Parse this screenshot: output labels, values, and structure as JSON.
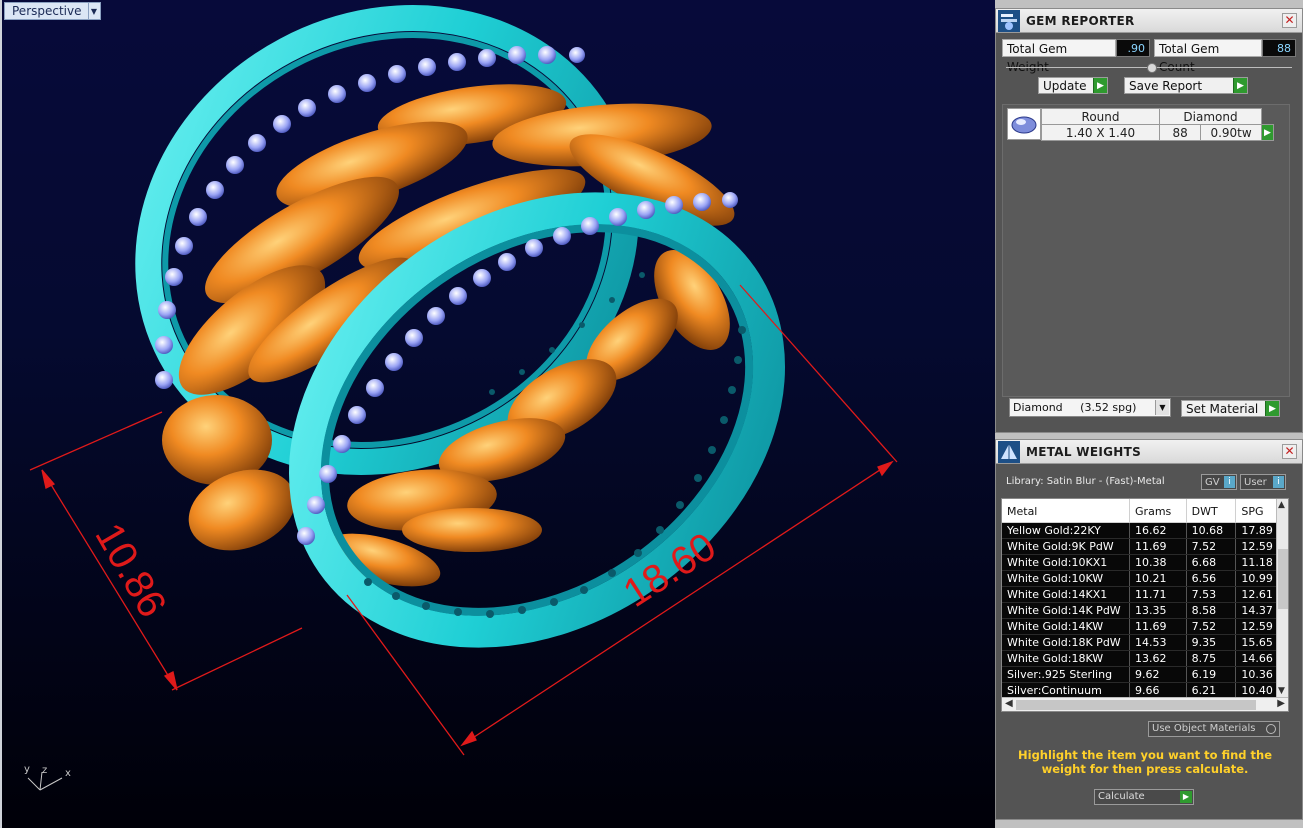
{
  "viewport": {
    "tab_label": "Perspective",
    "dimension_height": "10.86",
    "dimension_width": "18.60",
    "axis_labels": {
      "x": "x",
      "y": "y",
      "z": "z"
    },
    "colors": {
      "metal_gold": "#e98a2c",
      "setting_cyan": "#2ad4d8",
      "dimension": "#e01a1a"
    }
  },
  "gem_reporter": {
    "title": "GEM REPORTER",
    "close_glyph": "✕",
    "total_gem_weight_label": "Total Gem Weight",
    "total_gem_weight_value": ".90",
    "total_gem_count_label": "Total Gem Count",
    "total_gem_count_value": "88",
    "update_label": "Update",
    "save_report_label": "Save Report",
    "gem": {
      "shape": "Round",
      "material": "Diamond",
      "size": "1.40 X 1.40",
      "count": "88",
      "weight": "0.90tw"
    },
    "material_select_value": "Diamond     (3.52 spg)",
    "set_material_label": "Set Material"
  },
  "metal_weights": {
    "title": "METAL WEIGHTS",
    "close_glyph": "✕",
    "library_label": "Library: Satin Blur - (Fast)-Metal",
    "gv_label": "GV",
    "user_label": "User",
    "columns": [
      "Metal",
      "Grams",
      "DWT",
      "SPG"
    ],
    "rows": [
      [
        "Yellow Gold:22KY",
        "16.62",
        "10.68",
        "17.89"
      ],
      [
        "White Gold:9K PdW",
        "11.69",
        "7.52",
        "12.59"
      ],
      [
        "White Gold:10KX1",
        "10.38",
        "6.68",
        "11.18"
      ],
      [
        "White Gold:10KW",
        "10.21",
        "6.56",
        "10.99"
      ],
      [
        "White Gold:14KX1",
        "11.71",
        "7.53",
        "12.61"
      ],
      [
        "White Gold:14K PdW",
        "13.35",
        "8.58",
        "14.37"
      ],
      [
        "White Gold:14KW",
        "11.69",
        "7.52",
        "12.59"
      ],
      [
        "White Gold:18K PdW",
        "14.53",
        "9.35",
        "15.65"
      ],
      [
        "White Gold:18KW",
        "13.62",
        "8.75",
        "14.66"
      ],
      [
        "Silver:.925 Sterling",
        "9.62",
        "6.19",
        "10.36"
      ],
      [
        "Silver:Continuum",
        "9.66",
        "6.21",
        "10.40"
      ]
    ],
    "use_object_materials_label": "Use Object Materials",
    "hint": "Highlight the item you want to find the weight for then press calculate.",
    "calculate_label": "Calculate"
  }
}
